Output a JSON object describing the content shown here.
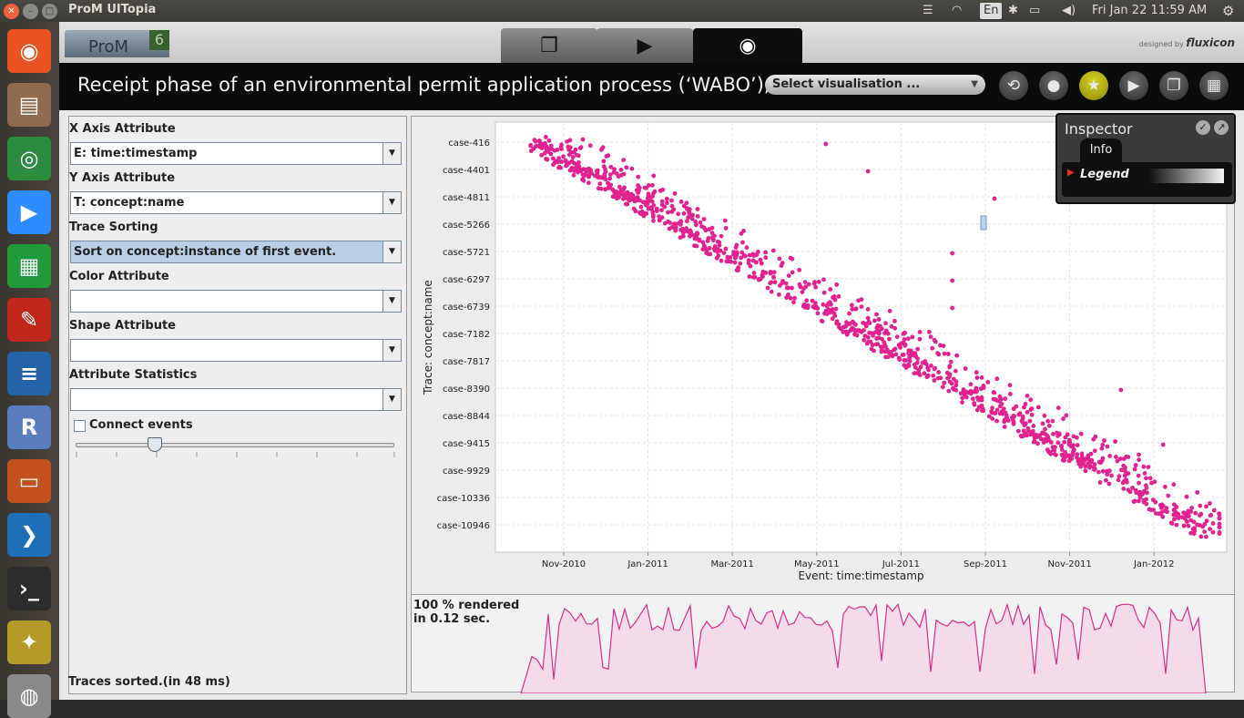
{
  "topbar": {
    "app_title": "ProM UITopia",
    "keyboard": "En",
    "clock": "Fri Jan 22 11:59 AM"
  },
  "launcher": {
    "apps": [
      {
        "name": "ubuntu-icon",
        "color": "#e95420",
        "glyph": "◉"
      },
      {
        "name": "files-icon",
        "color": "#8f6a4e",
        "glyph": "▤"
      },
      {
        "name": "chrome-icon",
        "color": "#2a8c3c",
        "glyph": "◎"
      },
      {
        "name": "zoom-icon",
        "color": "#2d8cff",
        "glyph": "▶"
      },
      {
        "name": "calc-icon",
        "color": "#1f9a3a",
        "glyph": "▦"
      },
      {
        "name": "pdf-reader-icon",
        "color": "#c0271c",
        "glyph": "✎"
      },
      {
        "name": "writer-icon",
        "color": "#2563a8",
        "glyph": "≡"
      },
      {
        "name": "r-icon",
        "color": "#5a7fc0",
        "glyph": "R"
      },
      {
        "name": "impress-icon",
        "color": "#c2511d",
        "glyph": "▭"
      },
      {
        "name": "vscode-icon",
        "color": "#1e6fb8",
        "glyph": "❯"
      },
      {
        "name": "terminal-icon",
        "color": "#2c2c2c",
        "glyph": "›_"
      },
      {
        "name": "prom-app-icon",
        "color": "#b59a2a",
        "glyph": "✦"
      },
      {
        "name": "disk-icon",
        "color": "#8a8a8a",
        "glyph": "◍"
      }
    ]
  },
  "prom": {
    "logo_text": "ProM",
    "logo_version": "6",
    "designed_by": "designed by",
    "designer": "fluxicon",
    "view_title": "Receipt phase of an environmental permit application process (‘WABO’), CoSeLoG project",
    "visualisation_select": "Select visualisation ..."
  },
  "left_panel": {
    "x_axis_label": "X Axis Attribute",
    "x_axis_value": "E: time:timestamp",
    "y_axis_label": "Y Axis Attribute",
    "y_axis_value": "T: concept:name",
    "sorting_label": "Trace Sorting",
    "sorting_value": "Sort on concept:instance of first event.",
    "color_label": "Color Attribute",
    "color_value": "",
    "shape_label": "Shape Attribute",
    "shape_value": "",
    "stats_label": "Attribute Statistics",
    "stats_value": "",
    "connect_label": "Connect events",
    "status": "Traces sorted.(in 48 ms)"
  },
  "render": {
    "line1": "100 % rendered",
    "line2": "in 0.12 sec."
  },
  "inspector": {
    "title": "Inspector",
    "tab": "Info",
    "legend": "Legend"
  },
  "chart_data": {
    "type": "scatter",
    "xlabel": "Event: time:timestamp",
    "ylabel": "Trace: concept:name",
    "x_ticks": [
      "Nov-2010",
      "Jan-2011",
      "Mar-2011",
      "May-2011",
      "Jul-2011",
      "Sep-2011",
      "Nov-2011",
      "Jan-2012"
    ],
    "y_ticks": [
      "case-416",
      "case-4401",
      "case-4811",
      "case-5266",
      "case-5721",
      "case-6297",
      "case-6739",
      "case-7182",
      "case-7817",
      "case-8390",
      "case-8844",
      "case-9415",
      "case-9929",
      "case-10336",
      "case-10946"
    ],
    "x_range_months": [
      "Sep-2010",
      "Feb-2012"
    ],
    "marker_color": "#e0238f",
    "grid": true,
    "trend": "events fall along a diagonal band: cases later in the ordering start later in time",
    "outliers": [
      {
        "x": "May-2011",
        "y": "case-416"
      },
      {
        "x": "Jun-2011",
        "y": "case-4401"
      },
      {
        "x": "Sep-2011",
        "y": "case-4811"
      },
      {
        "x": "Aug-2011",
        "y": "case-5721"
      },
      {
        "x": "Aug-2011",
        "y": "case-6297"
      },
      {
        "x": "Aug-2011",
        "y": "case-6739"
      },
      {
        "x": "Dec-2011",
        "y": "case-8390"
      },
      {
        "x": "Jan-2012",
        "y": "case-9415"
      }
    ]
  },
  "density_color": "#d62f8a"
}
